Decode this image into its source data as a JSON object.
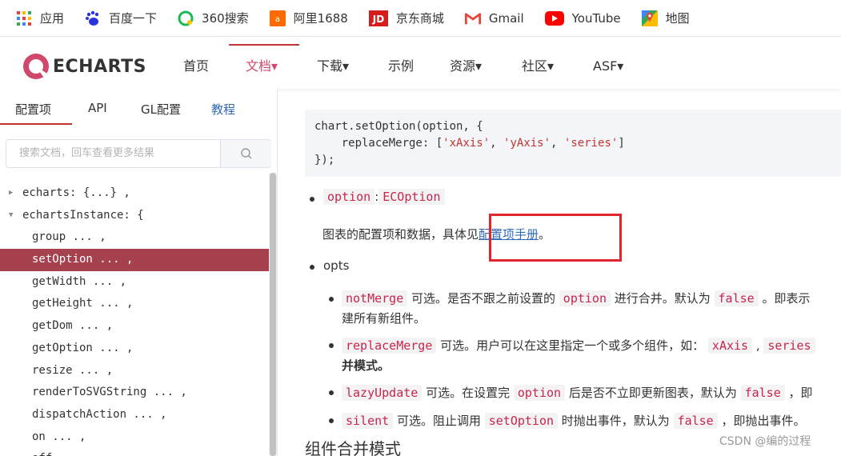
{
  "bookmarks": [
    {
      "label": "应用",
      "icon": "apps-grid-icon"
    },
    {
      "label": "百度一下",
      "icon": "baidu-paw-icon"
    },
    {
      "label": "360搜索",
      "icon": "search-360-icon"
    },
    {
      "label": "阿里1688",
      "icon": "alibaba-1688-icon"
    },
    {
      "label": "京东商城",
      "icon": "jd-icon"
    },
    {
      "label": "Gmail",
      "icon": "gmail-icon"
    },
    {
      "label": "YouTube",
      "icon": "youtube-icon"
    },
    {
      "label": "地图",
      "icon": "maps-icon"
    }
  ],
  "header": {
    "logo_text": "ECHARTS",
    "nav": [
      {
        "label": "首页"
      },
      {
        "label": "文档▾"
      },
      {
        "label": "下载▾"
      },
      {
        "label": "示例"
      },
      {
        "label": "资源▾"
      },
      {
        "label": "社区▾"
      },
      {
        "label": "ASF▾"
      }
    ],
    "accent": "#c23531"
  },
  "sidebar": {
    "tabs": [
      {
        "label": "配置项"
      },
      {
        "label": "API"
      },
      {
        "label": "GL配置"
      },
      {
        "label": "教程"
      }
    ],
    "search_placeholder": "搜索文档，回车查看更多结果",
    "tree": [
      {
        "label": "echarts: {...} ,",
        "arrow": "▶"
      },
      {
        "label": "echartsInstance: {",
        "arrow": "▼"
      },
      {
        "label": "group ... ,"
      },
      {
        "label": "setOption ... ,"
      },
      {
        "label": "getWidth ... ,"
      },
      {
        "label": "getHeight ... ,"
      },
      {
        "label": "getDom ... ,"
      },
      {
        "label": "getOption ... ,"
      },
      {
        "label": "resize ... ,"
      },
      {
        "label": "renderToSVGString ... ,"
      },
      {
        "label": "dispatchAction ... ,"
      },
      {
        "label": "on ... ,"
      },
      {
        "label": "off ... ,"
      }
    ]
  },
  "content": {
    "code_block": {
      "line1": "chart.setOption(option, {",
      "line2_key": "    replaceMerge: [",
      "line2_s1": "'xAxis'",
      "line2_s2": "'yAxis'",
      "line2_s3": "'series'",
      "line2_sep": ", ",
      "line2_end": "]",
      "line3": "});"
    },
    "param_option_name": "option",
    "param_option_colon": ":",
    "param_option_type": "ECOption",
    "option_desc_prefix": "图表的配置项和数据，具体见",
    "option_desc_link": "配置项手册",
    "option_desc_suffix": "。",
    "param_opts": "opts",
    "opts": [
      {
        "code": "notMerge",
        "t1": " 可选。是否不跟之前设置的 ",
        "code2": "option",
        "t2": " 进行合并。默认为 ",
        "code3": "false",
        "t3": " 。即表示",
        "line2": "建所有新组件。"
      },
      {
        "code": "replaceMerge",
        "t1": " 可选。用户可以在这里指定一个或多个组件，如： ",
        "code2": "xAxis",
        "t2": " , ",
        "code3": "series",
        "line2": "并模式。"
      },
      {
        "code": "lazyUpdate",
        "t1": " 可选。在设置完 ",
        "code2": "option",
        "t2": " 后是否不立即更新图表，默认为 ",
        "code3": "false",
        "t3": " ，即"
      },
      {
        "code": "silent",
        "t1": " 可选。阻止调用 ",
        "code2": "setOption",
        "t2": " 时抛出事件，默认为 ",
        "code3": "false",
        "t3": " ，即抛出事件。"
      }
    ],
    "section_title": "组件合并模式",
    "watermark": "CSDN @编的过程"
  }
}
